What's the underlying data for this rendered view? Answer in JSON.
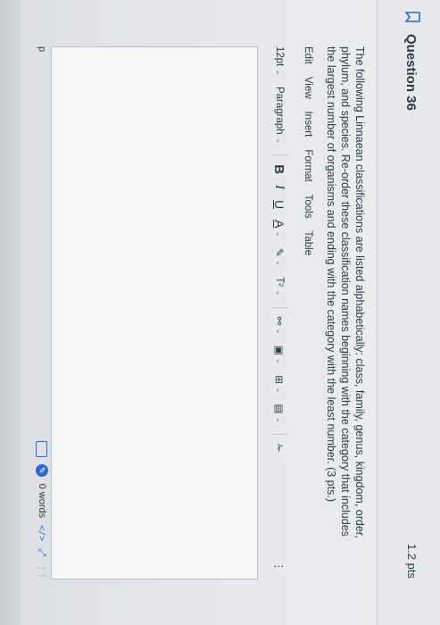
{
  "question": {
    "title": "Question 36",
    "points": "1.2 pts",
    "text": "The following Linnaean classifications are listed alphabetically: class, family, genus, kingdom, order, phylum, and species. Re-order these classification names beginning with the category that includes the largest number of organisms and ending with the category with the least number.  (3 pts.)"
  },
  "menubar": {
    "edit": "Edit",
    "view": "View",
    "insert": "Insert",
    "format": "Format",
    "tools": "Tools",
    "table": "Table"
  },
  "toolbar": {
    "font_size": "12pt",
    "block_format": "Paragraph",
    "bold": "B",
    "italic": "I",
    "underline": "U",
    "text_color": "A",
    "highlight": "✎",
    "superscript": "T²",
    "link": "⚯",
    "image": "▣",
    "media": "⊞",
    "embed": "▤",
    "clear": "✁",
    "more": "⋮"
  },
  "statusbar": {
    "path": "p",
    "word_count": "0 words",
    "html_toggle": "</>"
  },
  "colors": {
    "accent": "#2d6ad8",
    "text": "#2d3b45",
    "border": "#b9bfc5"
  }
}
